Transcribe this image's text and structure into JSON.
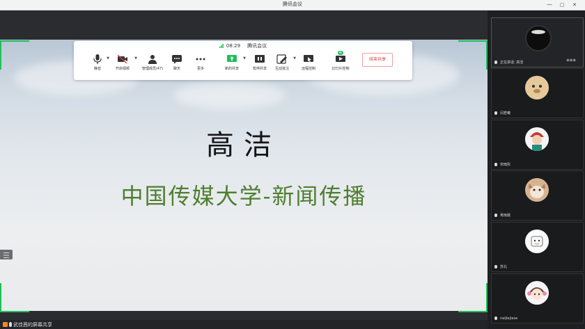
{
  "window": {
    "title": "腾讯会议",
    "min_label": "—",
    "max_label": "▢",
    "close_label": "✕"
  },
  "toolbar": {
    "time": "08:29",
    "app_name": "腾讯会议",
    "buttons": [
      {
        "label": "静音"
      },
      {
        "label": "开启视频"
      },
      {
        "label": "管理成员(47)"
      },
      {
        "label": "聊天"
      },
      {
        "label": "更多"
      },
      {
        "label": "新的共享"
      },
      {
        "label": "暂停共享"
      },
      {
        "label": "互动批注"
      },
      {
        "label": "远程控制"
      },
      {
        "label": "幻灯片控制",
        "badge": "新"
      }
    ],
    "end_label": "结束共享"
  },
  "slide": {
    "title": "高洁",
    "subtitle": "中国传媒大学-新闻传播"
  },
  "participants": [
    {
      "name": "正在讲话: 高洁"
    },
    {
      "name": "闫若曦"
    },
    {
      "name": "宋雨彤"
    },
    {
      "name": "吴雨晨"
    },
    {
      "name": "苏北"
    },
    {
      "name": "naijiejiasa"
    }
  ],
  "status": {
    "share_text": "武佳茜的屏幕共享"
  },
  "colors": {
    "accent": "#1fbf5a",
    "end_red": "#e23d3d",
    "subtitle_green": "#4e7e2e"
  }
}
